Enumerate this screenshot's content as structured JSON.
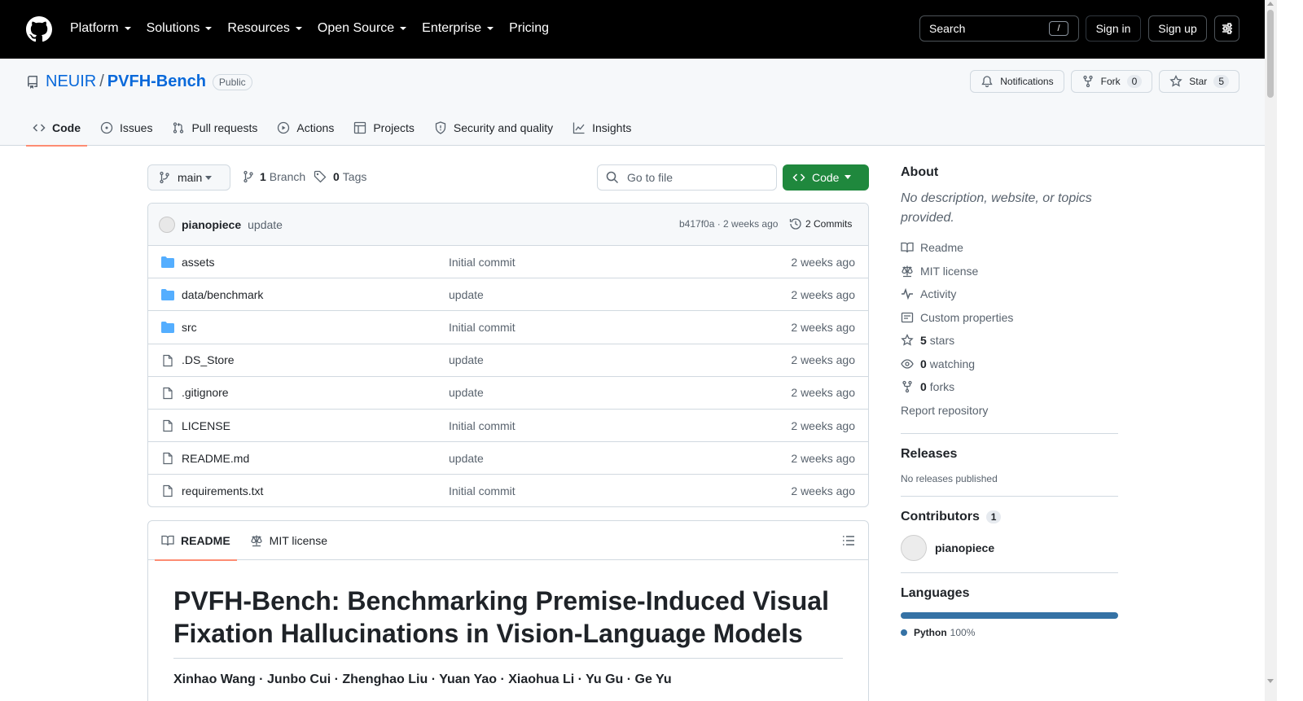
{
  "header": {
    "nav": [
      "Platform",
      "Solutions",
      "Resources",
      "Open Source",
      "Enterprise",
      "Pricing"
    ],
    "search_label": "Search",
    "search_key": "/",
    "signin": "Sign in",
    "signup": "Sign up"
  },
  "repo": {
    "owner": "NEUIR",
    "separator": "/",
    "name": "PVFH-Bench",
    "visibility": "Public",
    "notifications": "Notifications",
    "fork_label": "Fork",
    "fork_count": "0",
    "star_label": "Star",
    "star_count": "5",
    "tabs": [
      "Code",
      "Issues",
      "Pull requests",
      "Actions",
      "Projects",
      "Security and quality",
      "Insights"
    ]
  },
  "toolbar": {
    "branch": "main",
    "branch_count": "1",
    "branch_label": "Branch",
    "tag_count": "0",
    "tag_label": "Tags",
    "goto_placeholder": "Go to file",
    "code_label": "Code"
  },
  "commit": {
    "author": "pianopiece",
    "message": "update",
    "meta": "b417f0a · 2 weeks ago",
    "count": "2 Commits"
  },
  "files": [
    {
      "name": "assets",
      "type": "dir",
      "msg": "Initial commit",
      "age": "2 weeks ago"
    },
    {
      "name": "data/benchmark",
      "type": "dir",
      "msg": "update",
      "age": "2 weeks ago"
    },
    {
      "name": "src",
      "type": "dir",
      "msg": "Initial commit",
      "age": "2 weeks ago"
    },
    {
      "name": ".DS_Store",
      "type": "file",
      "msg": "update",
      "age": "2 weeks ago"
    },
    {
      "name": ".gitignore",
      "type": "file",
      "msg": "update",
      "age": "2 weeks ago"
    },
    {
      "name": "LICENSE",
      "type": "file",
      "msg": "Initial commit",
      "age": "2 weeks ago"
    },
    {
      "name": "README.md",
      "type": "file",
      "msg": "update",
      "age": "2 weeks ago"
    },
    {
      "name": "requirements.txt",
      "type": "file",
      "msg": "Initial commit",
      "age": "2 weeks ago"
    }
  ],
  "readme": {
    "tab_readme": "README",
    "tab_license": "MIT license",
    "title": "PVFH-Bench: Benchmarking Premise-Induced Visual Fixation Hallucinations in Vision-Language Models",
    "authors": "Xinhao Wang · Junbo Cui · Zhenghao Liu · Yuan Yao · Xiaohua Li · Yu Gu · Ge Yu"
  },
  "sidebar": {
    "about_title": "About",
    "about_desc": "No description, website, or topics provided.",
    "readme": "Readme",
    "license": "MIT license",
    "activity": "Activity",
    "custom_props": "Custom properties",
    "stars_count": "5",
    "stars_label": "stars",
    "watching_count": "0",
    "watching_label": "watching",
    "forks_count": "0",
    "forks_label": "forks",
    "report": "Report repository",
    "releases_title": "Releases",
    "releases_none": "No releases published",
    "contributors_title": "Contributors",
    "contributors_count": "1",
    "contributor_name": "pianopiece",
    "languages_title": "Languages",
    "language_name": "Python",
    "language_pct": "100%",
    "language_color": "#3572A5"
  },
  "colors": {
    "accent_link": "#0969da",
    "code_button": "#1f883d",
    "tab_underline": "#fd8c73",
    "folder": "#54aeff"
  }
}
